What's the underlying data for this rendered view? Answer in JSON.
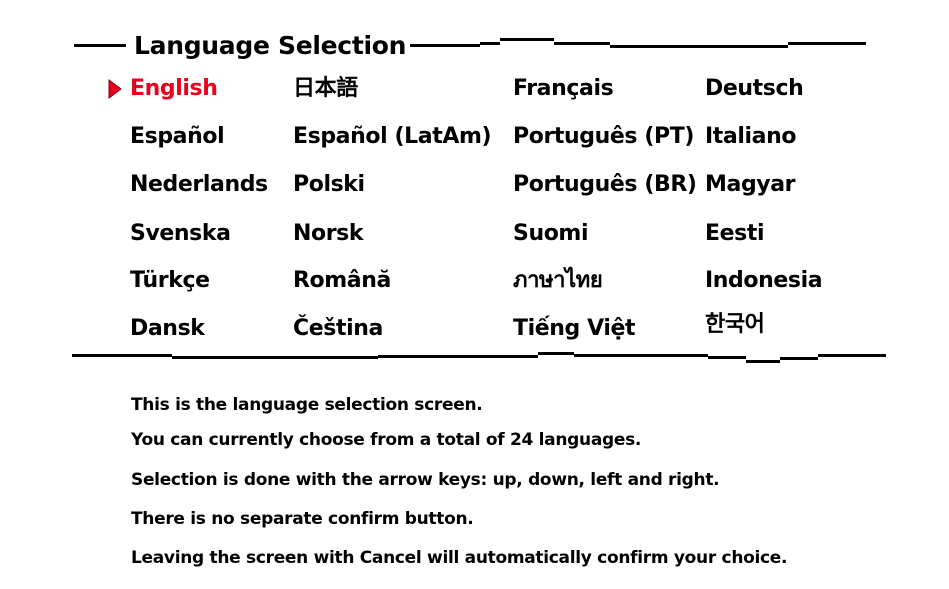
{
  "title": "Language Selection",
  "colors": {
    "background": "#ffffff",
    "text": "#000000",
    "selected": "#e8001c"
  },
  "cursor_icon": "red-triangle-pointer",
  "selected_language": "English",
  "languages": [
    [
      "English",
      "日本語",
      "Français",
      "Deutsch"
    ],
    [
      "Español",
      "Español (LatAm)",
      "Português (PT)",
      "Italiano"
    ],
    [
      "Nederlands",
      "Polski",
      "Português (BR)",
      "Magyar"
    ],
    [
      "Svenska",
      "Norsk",
      "Suomi",
      "Eesti"
    ],
    [
      "Türkçe",
      "Română",
      "ภาษาไทย",
      "Indonesia"
    ],
    [
      "Dansk",
      "Čeština",
      "Tiếng Việt",
      "한국어"
    ]
  ],
  "description": [
    "This is the language selection screen.",
    "You can currently choose from a total of 24 languages.",
    "Selection is done with the arrow keys: up, down, left and right.",
    "There is no separate confirm button.",
    "Leaving the screen with Cancel will automatically confirm your choice."
  ]
}
